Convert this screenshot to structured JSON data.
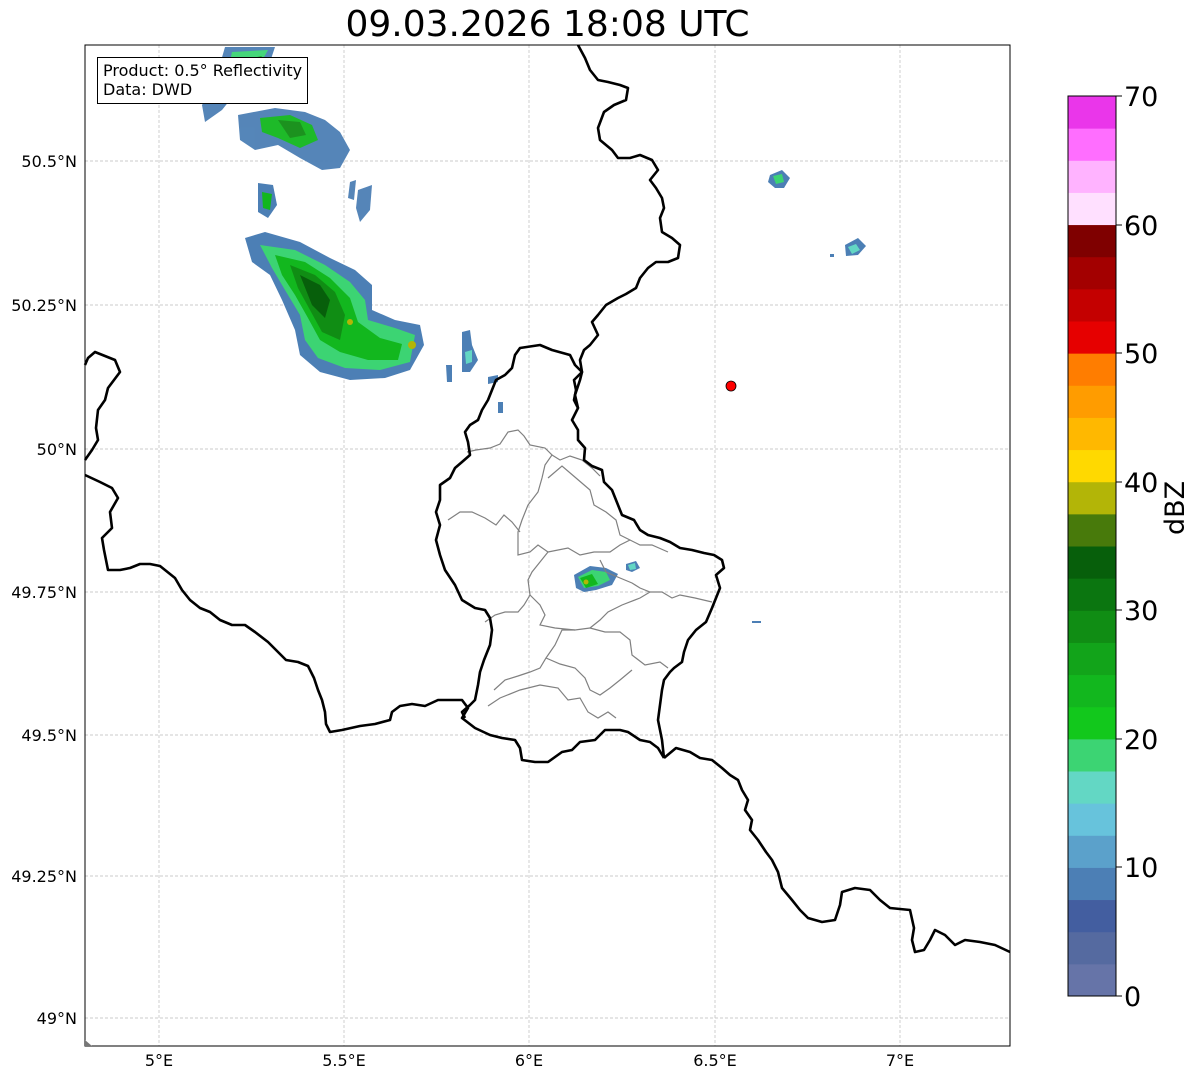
{
  "title": "09.03.2026 18:08 UTC",
  "info": {
    "product_line": "Product: 0.5° Reflectivity",
    "data_line": "Data: DWD"
  },
  "axes": {
    "lat_ticks": [
      "50.5°N",
      "50.25°N",
      "50°N",
      "49.75°N",
      "49.5°N",
      "49.25°N",
      "49°N"
    ],
    "lon_ticks": [
      "5°E",
      "5.5°E",
      "6°E",
      "6.5°E",
      "7°E"
    ]
  },
  "colorbar": {
    "label": "dBZ",
    "tick_labels": [
      "0",
      "10",
      "20",
      "30",
      "40",
      "50",
      "60",
      "70"
    ],
    "colors": [
      "#6674a8",
      "#556aa0",
      "#435ea0",
      "#4c7fb5",
      "#5ba1cb",
      "#67c3dc",
      "#63d7c4",
      "#3cd473",
      "#12c81c",
      "#12b71e",
      "#12a41a",
      "#108d14",
      "#0b7610",
      "#075f0b",
      "#487a0b",
      "#b3b507",
      "#ffd900",
      "#ffb800",
      "#ff9c00",
      "#ff7d00",
      "#e60000",
      "#c40000",
      "#a30000",
      "#7f0000",
      "#ffe0ff",
      "#ffb3ff",
      "#ff6eff",
      "#ea36ea"
    ]
  },
  "marker": {
    "name": "radar-site",
    "color": "#ff0000"
  }
}
